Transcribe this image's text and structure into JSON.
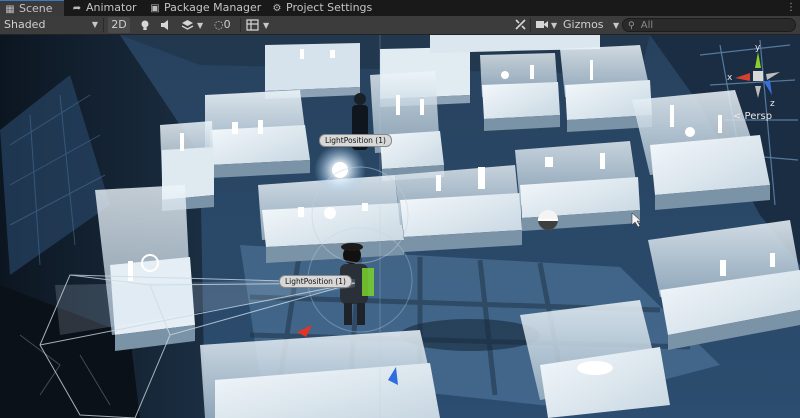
{
  "tabs": {
    "scene": "Scene",
    "animator": "Animator",
    "package_manager": "Package Manager",
    "project_settings": "Project Settings"
  },
  "toolbar": {
    "shading_mode": "Shaded",
    "mode_2d": "2D",
    "hidden_count": "0",
    "gizmos": "Gizmos",
    "search_placeholder": "All"
  },
  "viewport": {
    "light_labels": [
      "LightPosition (1)",
      "LightPosition (1)"
    ],
    "gizmo_axes": {
      "y": "y",
      "x": "x",
      "z": "z"
    },
    "projection": "< Persp"
  },
  "colors": {
    "tab_accent": "#3a79bb",
    "toolbar_bg": "#3c3c3c",
    "floor": "#3f5d7d",
    "axis_x": "#d5402f",
    "axis_y": "#8bd12d",
    "axis_z": "#3a6fd8"
  }
}
